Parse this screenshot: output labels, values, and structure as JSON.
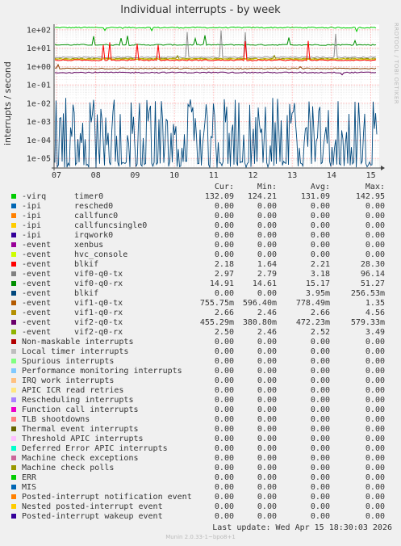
{
  "title": "Individual interrupts - by week",
  "side_text": "RRDTOOL / TOBI OETIKER",
  "chart_data": {
    "type": "line",
    "title": "Individual interrupts - by week",
    "ylabel": "interrupts / second",
    "yscale": "log",
    "ylim": [
      3e-06,
      200
    ],
    "y_ticks": [
      "1e+02",
      "1e+01",
      "1e+00",
      "1e-01",
      "1e-02",
      "1e-03",
      "1e-04",
      "1e-05"
    ],
    "x_ticks": [
      "07",
      "08",
      "09",
      "10",
      "11",
      "12",
      "13",
      "14",
      "15"
    ],
    "series": [
      {
        "name": "timer0",
        "color": "#00cc00",
        "values": [
          132.09,
          124.21,
          131.09,
          142.95
        ]
      },
      {
        "name": "vif0-q0-rx",
        "color": "#008f00",
        "values": [
          14.91,
          14.61,
          15.17,
          51.27
        ]
      },
      {
        "name": "vif0-q0-tx",
        "color": "#8f8f8f",
        "values": [
          2.97,
          2.79,
          3.18,
          96.14
        ]
      },
      {
        "name": "vif1-q0-rx",
        "color": "#8f8f00",
        "values": [
          2.66,
          2.46,
          2.66,
          4.56
        ]
      },
      {
        "name": "vif2-q0-rx",
        "color": "#cccc00",
        "values": [
          2.5,
          2.46,
          2.52,
          3.49
        ]
      },
      {
        "name": "blkif",
        "color": "#ff0000",
        "values": [
          2.18,
          1.64,
          2.21,
          28.3
        ]
      },
      {
        "name": "vif1-q0-tx",
        "color": "#8f3f00",
        "values": [
          0.75575,
          0.5964,
          0.77849,
          1.35
        ]
      },
      {
        "name": "vif2-q0-tx",
        "color": "#5f005f",
        "values": [
          0.45529,
          0.3808,
          0.47223,
          0.57933
        ]
      },
      {
        "name": "blkif (event)",
        "color": "#00487d",
        "values": [
          0,
          0,
          0.00395,
          0.25653
        ]
      }
    ]
  },
  "legend": {
    "headers": [
      "Cur:",
      "Min:",
      "Avg:",
      "Max:"
    ],
    "rows": [
      {
        "color": "#00cc00",
        "name": "-virq",
        "sub": "timer0",
        "cur": "132.09",
        "min": "124.21",
        "avg": "131.09",
        "max": "142.95"
      },
      {
        "color": "#0066b3",
        "name": "-ipi",
        "sub": "resched0",
        "cur": "0.00",
        "min": "0.00",
        "avg": "0.00",
        "max": "0.00"
      },
      {
        "color": "#ff8000",
        "name": "-ipi",
        "sub": "callfunc0",
        "cur": "0.00",
        "min": "0.00",
        "avg": "0.00",
        "max": "0.00"
      },
      {
        "color": "#ffcc00",
        "name": "-ipi",
        "sub": "callfuncsingle0",
        "cur": "0.00",
        "min": "0.00",
        "avg": "0.00",
        "max": "0.00"
      },
      {
        "color": "#330099",
        "name": "-ipi",
        "sub": "irqwork0",
        "cur": "0.00",
        "min": "0.00",
        "avg": "0.00",
        "max": "0.00"
      },
      {
        "color": "#990099",
        "name": "-event",
        "sub": "xenbus",
        "cur": "0.00",
        "min": "0.00",
        "avg": "0.00",
        "max": "0.00"
      },
      {
        "color": "#ccff00",
        "name": "-event",
        "sub": "hvc_console",
        "cur": "0.00",
        "min": "0.00",
        "avg": "0.00",
        "max": "0.00"
      },
      {
        "color": "#ff0000",
        "name": "-event",
        "sub": "blkif",
        "cur": "2.18",
        "min": "1.64",
        "avg": "2.21",
        "max": "28.30"
      },
      {
        "color": "#808080",
        "name": "-event",
        "sub": "vif0-q0-tx",
        "cur": "2.97",
        "min": "2.79",
        "avg": "3.18",
        "max": "96.14"
      },
      {
        "color": "#008f00",
        "name": "-event",
        "sub": "vif0-q0-rx",
        "cur": "14.91",
        "min": "14.61",
        "avg": "15.17",
        "max": "51.27"
      },
      {
        "color": "#00487d",
        "name": "-event",
        "sub": "blkif",
        "cur": "0.00",
        "min": "0.00",
        "avg": "3.95m",
        "max": "256.53m"
      },
      {
        "color": "#b35a00",
        "name": "-event",
        "sub": "vif1-q0-tx",
        "cur": "755.75m",
        "min": "596.40m",
        "avg": "778.49m",
        "max": "1.35"
      },
      {
        "color": "#b38f00",
        "name": "-event",
        "sub": "vif1-q0-rx",
        "cur": "2.66",
        "min": "2.46",
        "avg": "2.66",
        "max": "4.56"
      },
      {
        "color": "#6b006b",
        "name": "-event",
        "sub": "vif2-q0-tx",
        "cur": "455.29m",
        "min": "380.80m",
        "avg": "472.23m",
        "max": "579.33m"
      },
      {
        "color": "#8fb300",
        "name": "-event",
        "sub": "vif2-q0-rx",
        "cur": "2.50",
        "min": "2.46",
        "avg": "2.52",
        "max": "3.49"
      },
      {
        "color": "#b30000",
        "name": "Non-maskable interrupts",
        "sub": "",
        "cur": "0.00",
        "min": "0.00",
        "avg": "0.00",
        "max": "0.00"
      },
      {
        "color": "#bebebe",
        "name": "Local timer interrupts",
        "sub": "",
        "cur": "0.00",
        "min": "0.00",
        "avg": "0.00",
        "max": "0.00"
      },
      {
        "color": "#80ff80",
        "name": "Spurious interrupts",
        "sub": "",
        "cur": "0.00",
        "min": "0.00",
        "avg": "0.00",
        "max": "0.00"
      },
      {
        "color": "#80c9ff",
        "name": "Performance monitoring interrupts",
        "sub": "",
        "cur": "0.00",
        "min": "0.00",
        "avg": "0.00",
        "max": "0.00"
      },
      {
        "color": "#ffc080",
        "name": "IRQ work interrupts",
        "sub": "",
        "cur": "0.00",
        "min": "0.00",
        "avg": "0.00",
        "max": "0.00"
      },
      {
        "color": "#ffe680",
        "name": "APIC ICR read retries",
        "sub": "",
        "cur": "0.00",
        "min": "0.00",
        "avg": "0.00",
        "max": "0.00"
      },
      {
        "color": "#aa80ff",
        "name": "Rescheduling interrupts",
        "sub": "",
        "cur": "0.00",
        "min": "0.00",
        "avg": "0.00",
        "max": "0.00"
      },
      {
        "color": "#ee00cc",
        "name": "Function call interrupts",
        "sub": "",
        "cur": "0.00",
        "min": "0.00",
        "avg": "0.00",
        "max": "0.00"
      },
      {
        "color": "#ff8080",
        "name": "TLB shootdowns",
        "sub": "",
        "cur": "0.00",
        "min": "0.00",
        "avg": "0.00",
        "max": "0.00"
      },
      {
        "color": "#666600",
        "name": "Thermal event interrupts",
        "sub": "",
        "cur": "0.00",
        "min": "0.00",
        "avg": "0.00",
        "max": "0.00"
      },
      {
        "color": "#ffbfff",
        "name": "Threshold APIC interrupts",
        "sub": "",
        "cur": "0.00",
        "min": "0.00",
        "avg": "0.00",
        "max": "0.00"
      },
      {
        "color": "#00ffcc",
        "name": "Deferred Error APIC interrupts",
        "sub": "",
        "cur": "0.00",
        "min": "0.00",
        "avg": "0.00",
        "max": "0.00"
      },
      {
        "color": "#cc6699",
        "name": "Machine check exceptions",
        "sub": "",
        "cur": "0.00",
        "min": "0.00",
        "avg": "0.00",
        "max": "0.00"
      },
      {
        "color": "#999900",
        "name": "Machine check polls",
        "sub": "",
        "cur": "0.00",
        "min": "0.00",
        "avg": "0.00",
        "max": "0.00"
      },
      {
        "color": "#00cc00",
        "name": "ERR",
        "sub": "",
        "cur": "0.00",
        "min": "0.00",
        "avg": "0.00",
        "max": "0.00"
      },
      {
        "color": "#0066b3",
        "name": "MIS",
        "sub": "",
        "cur": "0.00",
        "min": "0.00",
        "avg": "0.00",
        "max": "0.00"
      },
      {
        "color": "#ff8000",
        "name": "Posted-interrupt notification event",
        "sub": "",
        "cur": "0.00",
        "min": "0.00",
        "avg": "0.00",
        "max": "0.00"
      },
      {
        "color": "#ffcc00",
        "name": "Nested posted-interrupt event",
        "sub": "",
        "cur": "0.00",
        "min": "0.00",
        "avg": "0.00",
        "max": "0.00"
      },
      {
        "color": "#330099",
        "name": "Posted-interrupt wakeup event",
        "sub": "",
        "cur": "0.00",
        "min": "0.00",
        "avg": "0.00",
        "max": "0.00"
      }
    ]
  },
  "last_update": "Last update: Wed Apr 15 18:30:03 2026",
  "footer": "Munin 2.0.33-1~bpo8+1"
}
